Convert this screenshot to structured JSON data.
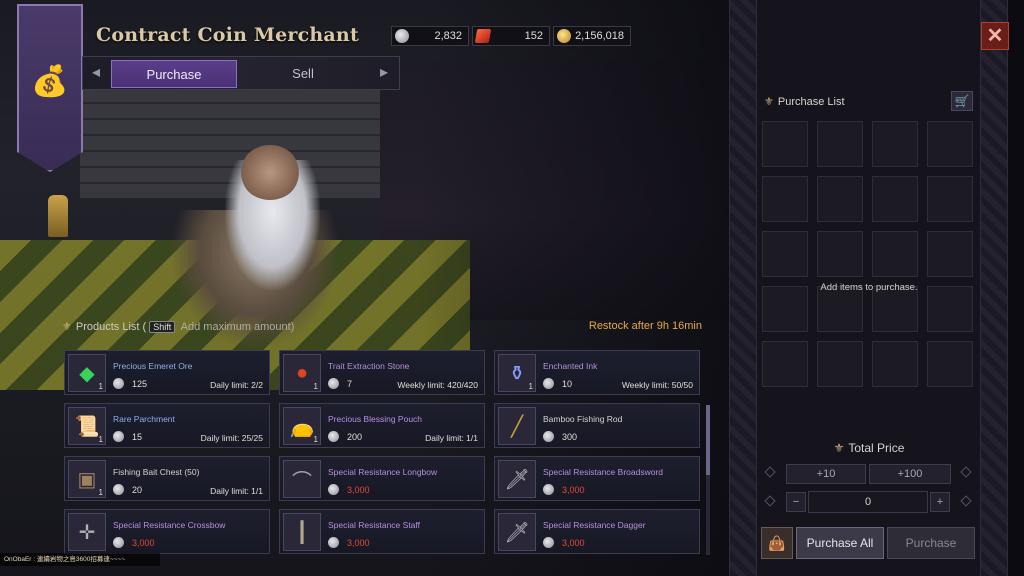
{
  "window": {
    "title": "Contract Coin Merchant",
    "close_icon": "close-icon"
  },
  "currencies": [
    {
      "icon": "silver-coin-icon",
      "value": "2,832"
    },
    {
      "icon": "red-ticket-icon",
      "value": "152"
    },
    {
      "icon": "gold-coin-icon",
      "value": "2,156,018"
    }
  ],
  "tabs": [
    {
      "label": "Purchase",
      "active": true
    },
    {
      "label": "Sell",
      "active": false
    }
  ],
  "products_list": {
    "label": "Products List",
    "shift_key": "Shift",
    "hint": "Add maximum amount)",
    "restock": "Restock after  9h 16min",
    "items": [
      {
        "name": "Precious Emeret Ore",
        "price": "125",
        "limit": "Daily limit: 2/2",
        "qty": "1",
        "icon": "green-gem-icon",
        "color": "blue"
      },
      {
        "name": "Trait Extraction Stone",
        "price": "7",
        "limit": "Weekly limit: 420/420",
        "qty": "1",
        "icon": "red-stone-icon",
        "color": "purple"
      },
      {
        "name": "Enchanted Ink",
        "price": "10",
        "limit": "Weekly limit: 50/50",
        "qty": "1",
        "icon": "ink-bottle-icon",
        "color": "purple"
      },
      {
        "name": "Rare Parchment",
        "price": "15",
        "limit": "Daily limit: 25/25",
        "qty": "1",
        "icon": "scroll-icon",
        "color": "blue"
      },
      {
        "name": "Precious Blessing Pouch",
        "price": "200",
        "limit": "Daily limit: 1/1",
        "qty": "1",
        "icon": "pouch-icon",
        "color": "purple"
      },
      {
        "name": "Bamboo Fishing Rod",
        "price": "300",
        "limit": "",
        "qty": "",
        "icon": "fishing-rod-icon",
        "color": "white"
      },
      {
        "name": "Fishing Bait Chest (50)",
        "price": "20",
        "limit": "Daily limit: 1/1",
        "qty": "1",
        "icon": "chest-icon",
        "color": "white"
      },
      {
        "name": "Special Resistance Longbow",
        "price": "3,000",
        "limit": "",
        "qty": "",
        "icon": "longbow-icon",
        "color": "purple"
      },
      {
        "name": "Special Resistance Broadsword",
        "price": "3,000",
        "limit": "",
        "qty": "",
        "icon": "broadsword-icon",
        "color": "purple"
      },
      {
        "name": "Special Resistance Crossbow",
        "price": "3,000",
        "limit": "",
        "qty": "",
        "icon": "crossbow-icon",
        "color": "purple"
      },
      {
        "name": "Special Resistance Staff",
        "price": "3,000",
        "limit": "",
        "qty": "",
        "icon": "staff-icon",
        "color": "purple"
      },
      {
        "name": "Special Resistance Dagger",
        "price": "3,000",
        "limit": "",
        "qty": "",
        "icon": "dagger-icon",
        "color": "purple"
      }
    ]
  },
  "purchase_list": {
    "label": "Purchase List",
    "empty_message": "Add items to purchase.",
    "total_label": "Total Price",
    "plus10": "+10",
    "plus100": "+100",
    "minus": "−",
    "plus": "+",
    "quantity": "0",
    "purchase_all": "Purchase All",
    "purchase": "Purchase"
  },
  "chat": {
    "text": "OnObaEr : 連續岩物之島3600招募連~~~~"
  },
  "colors": {
    "accent_purple": "#5b3e8a",
    "restock_orange": "#e9a842",
    "price_red": "#e04a3a",
    "name_blue": "#8fb0e8",
    "name_purple": "#b58fe0"
  }
}
